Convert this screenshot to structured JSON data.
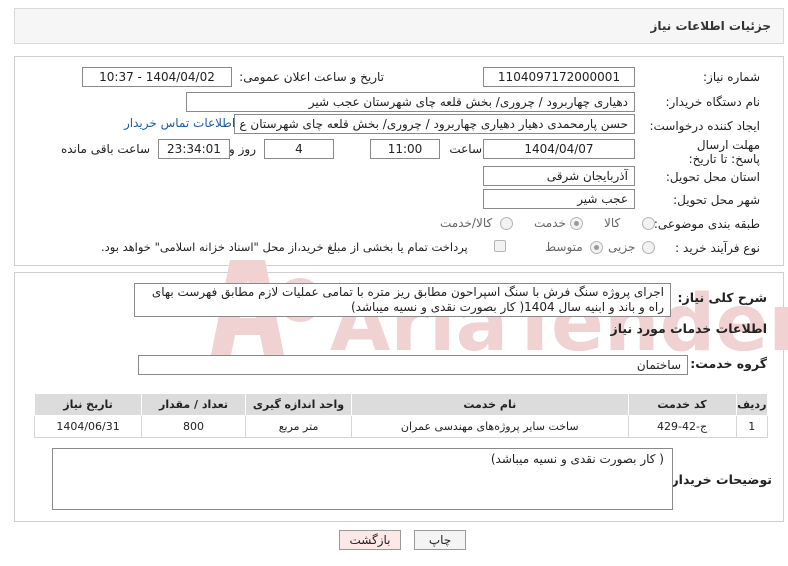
{
  "header": {
    "title": "جزئیات اطلاعات نیاز"
  },
  "form": {
    "need_number_label": "شماره نیاز:",
    "need_number": "1104097172000001",
    "announce_label": "تاریخ و ساعت اعلان عمومی:",
    "announce_value": "1404/04/02 - 10:37",
    "buyer_org_label": "نام دستگاه خریدار:",
    "buyer_org": "دهیاری چهاربرود / چروری/ بخش قلعه چای شهرستان عجب شیر",
    "requester_label": "ایجاد کننده درخواست:",
    "requester": "حسن پارمحمدی دهیار دهیاری چهاربرود / چروری/ بخش قلعه چای شهرستان ع",
    "contact_link": "اطلاعات تماس خریدار",
    "deadline_label": "مهلت ارسال پاسخ: تا تاریخ:",
    "deadline_date": "1404/04/07",
    "time_label": "ساعت",
    "deadline_time": "11:00",
    "days_value": "4",
    "days_label": "روز و",
    "remaining_time": "23:34:01",
    "remaining_label": "ساعت باقی مانده",
    "province_label": "استان محل تحویل:",
    "province": "آذربایجان شرقی",
    "city_label": "شهر محل تحویل:",
    "city": "عجب شیر",
    "category_label": "طبقه بندی موضوعی:",
    "category_options": [
      "کالا",
      "خدمت",
      "کالا/خدمت"
    ],
    "category_selected": "خدمت",
    "process_label": "نوع فرآیند خرید :",
    "process_options": [
      "جزیی",
      "متوسط"
    ],
    "process_selected": "متوسط",
    "payment_note": "پرداخت تمام یا بخشی از مبلغ خرید،از محل \"اسناد خزانه اسلامی\" خواهد بود."
  },
  "description": {
    "label": "شرح کلی نیاز:",
    "text": "اجرای پروژه سنگ فرش با سنگ اسپراحون مطابق ریز متره با تمامی عملیات لازم مطابق فهرست بهای راه و باند و ابنیه سال 1404( کار بصورت نقدی و نسیه میباشد)"
  },
  "services": {
    "section_title": "اطلاعات خدمات مورد نیاز",
    "group_label": "گروه خدمت:",
    "group_value": "ساختمان",
    "columns": [
      "ردیف",
      "کد خدمت",
      "نام خدمت",
      "واحد اندازه گیری",
      "تعداد / مقدار",
      "تاریخ نیاز"
    ],
    "rows": [
      {
        "row": "1",
        "code": "ج-42-429",
        "name": "ساخت سایر پروژه‌های مهندسی عمران",
        "unit": "متر مربع",
        "qty": "800",
        "date": "1404/06/31"
      }
    ]
  },
  "buyer_notes": {
    "label": "توضیحات خریدار:",
    "text": "( کار بصورت نقدی و نسیه میباشد)"
  },
  "buttons": {
    "print": "چاپ",
    "back": "بازگشت"
  },
  "watermark": {
    "text": "AriaTender.neT"
  },
  "colors": {
    "link": "#1a5ea8",
    "back_button_bg": "#fde8e8",
    "table_header": "#dcdcdc",
    "watermark": "#f1d2d2"
  }
}
